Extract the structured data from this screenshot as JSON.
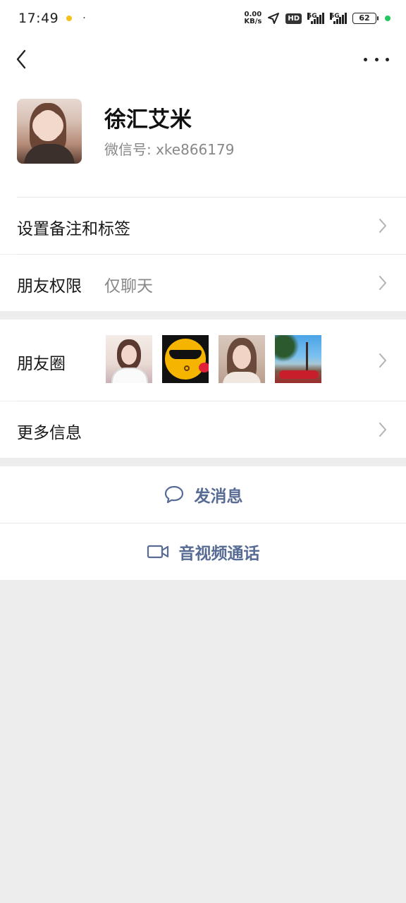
{
  "status_bar": {
    "time": "17:49",
    "dot": "·",
    "net_speed_value": "0.00",
    "net_speed_unit": "KB/s",
    "hd_label": "HD",
    "signal1_label": "5G",
    "signal2_label": "5G",
    "battery": "62"
  },
  "nav": {
    "back_icon": "chevron-left-icon",
    "more_icon": "more-horizontal-icon"
  },
  "profile": {
    "name": "徐汇艾米",
    "wechat_id": "微信号: xke866179"
  },
  "cells": {
    "remark_label": "设置备注和标签",
    "permission_label": "朋友权限",
    "permission_value": "仅聊天",
    "moments_label": "朋友圈",
    "more_info_label": "更多信息"
  },
  "actions": {
    "message_label": "发消息",
    "message_icon": "chat-bubble-icon",
    "call_label": "音视频通话",
    "call_icon": "video-camera-icon"
  },
  "colors": {
    "accent": "#576b95",
    "background": "#ededed",
    "status_green": "#22c55e"
  }
}
